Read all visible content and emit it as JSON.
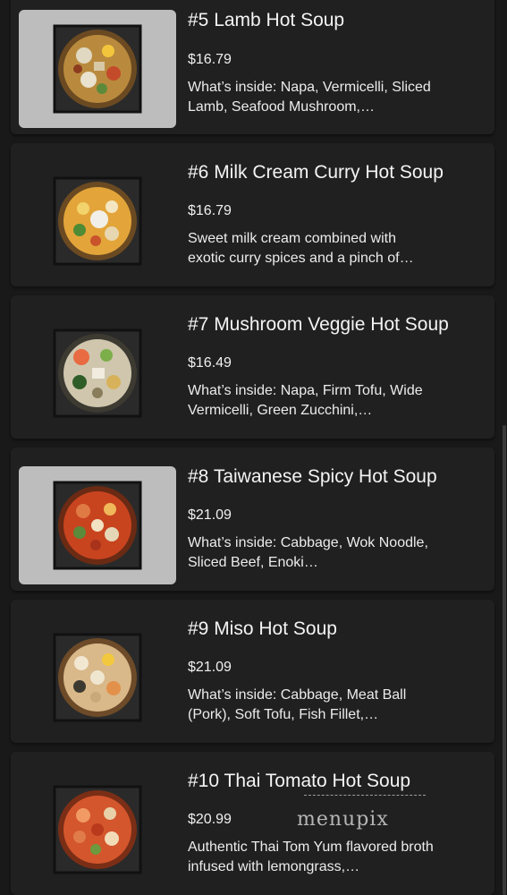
{
  "menu_items": [
    {
      "title": "#5 Lamb Hot Soup",
      "price": "$16.79",
      "description": "What’s inside: Napa, Vermicelli, Sliced Lamb, Seafood Mushroom,…",
      "image_icon": "lamb-hot-soup-photo"
    },
    {
      "title": "#6 Milk Cream Curry Hot Soup",
      "price": "$16.79",
      "description": "Sweet milk cream combined with exotic curry spices and a pinch of…",
      "image_icon": "milk-cream-curry-photo"
    },
    {
      "title": "#7 Mushroom Veggie Hot Soup",
      "price": "$16.49",
      "description": "What’s inside: Napa, Firm Tofu, Wide Vermicelli, Green Zucchini,…",
      "image_icon": "mushroom-veggie-photo"
    },
    {
      "title": "#8 Taiwanese Spicy Hot Soup",
      "price": "$21.09",
      "description": "What’s inside: Cabbage, Wok Noodle, Sliced Beef, Enoki…",
      "image_icon": "taiwanese-spicy-photo"
    },
    {
      "title": "#9 Miso Hot Soup",
      "price": "$21.09",
      "description": "What’s inside: Cabbage, Meat Ball (Pork), Soft Tofu, Fish Fillet,…",
      "image_icon": "miso-hot-soup-photo"
    },
    {
      "title": "#10 Thai Tomato Hot Soup",
      "price": "$20.99",
      "description": "Authentic Thai Tom Yum flavored broth infused with lemongrass,…",
      "image_icon": "thai-tomato-photo"
    }
  ],
  "watermark": "menupix",
  "colors": {
    "background": "#191919",
    "card": "#202020",
    "thumb_frame": "#bdbdbd",
    "text": "#f2f2f2"
  }
}
